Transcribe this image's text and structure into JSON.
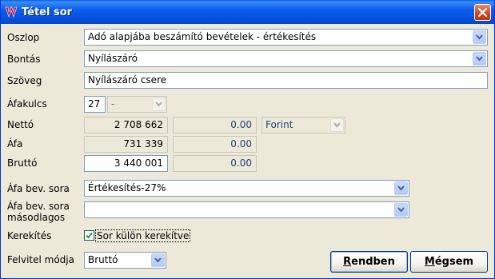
{
  "window": {
    "title": "Tétel sor"
  },
  "labels": {
    "oszlop": "Oszlop",
    "bontas": "Bontás",
    "szoveg": "Szöveg",
    "afakulcs": "Áfakulcs",
    "netto": "Nettó",
    "afa": "Áfa",
    "brutto": "Bruttó",
    "afa_bev_sora": "Áfa bev. sora",
    "afa_bev_sora_masodlagos_1": "Áfa bev. sora",
    "afa_bev_sora_masodlagos_2": "másodlagos",
    "kerekites": "Kerekítés",
    "felvitel_modja": "Felvitel módja"
  },
  "fields": {
    "oszlop": "Adó alapjába beszámító bevételek - értékesítés",
    "bontas": "Nyílászáró",
    "szoveg": "Nyílászáró csere",
    "afakulcs_code": "27",
    "afakulcs_select": "-",
    "netto": "2 708 662",
    "netto_2": "0.00",
    "currency": "Forint",
    "afa": "731 339",
    "afa_2": "0.00",
    "brutto": "3 440 001",
    "brutto_2": "0.00",
    "afa_bev_sora": "Értékesítés-27%",
    "afa_bev_sora_masodlagos": "",
    "kerekites_checkbox": "Sor külön kerekítve",
    "kerekites_checked": true,
    "felvitel_modja": "Bruttó"
  },
  "buttons": {
    "ok_first": "R",
    "ok_rest": "endben",
    "cancel_first": "M",
    "cancel_rest": "égsem"
  },
  "colors": {
    "titlebar": "#0553e0",
    "window_bg": "#ece9d8",
    "field_border": "#7f9db9"
  }
}
